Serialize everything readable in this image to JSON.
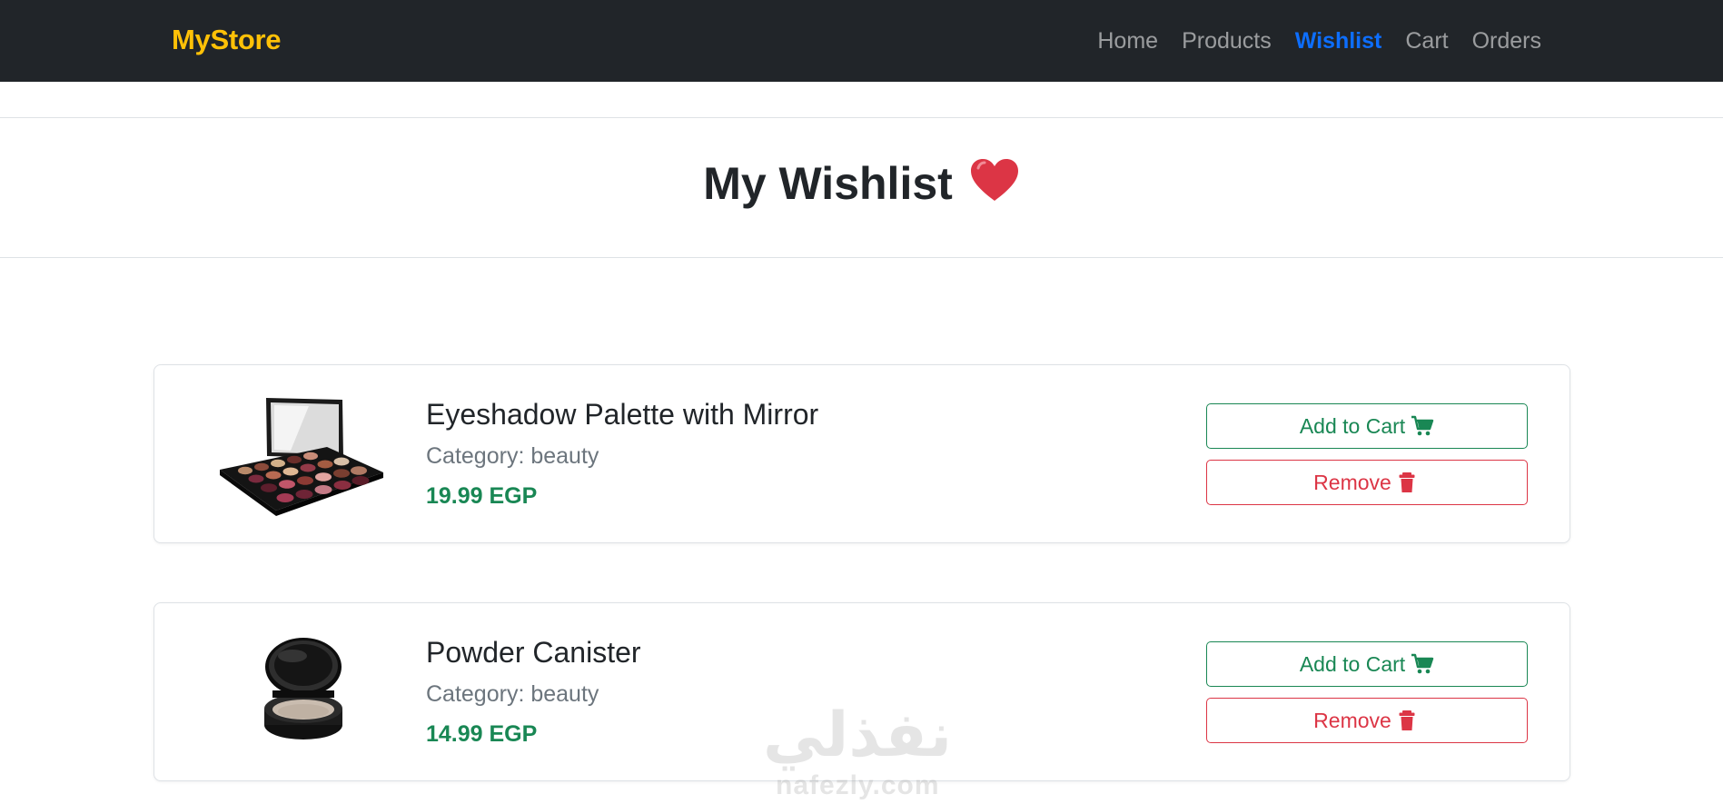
{
  "navbar": {
    "brand": "MyStore",
    "links": [
      {
        "label": "Home",
        "active": false
      },
      {
        "label": "Products",
        "active": false
      },
      {
        "label": "Wishlist",
        "active": true
      },
      {
        "label": "Cart",
        "active": false
      },
      {
        "label": "Orders",
        "active": false
      }
    ],
    "colors": {
      "background": "#212529",
      "brand": "#ffc107",
      "active_link": "#0d6efd"
    }
  },
  "page": {
    "title": "My Wishlist",
    "title_icon": "heart-icon"
  },
  "wishlist": {
    "items": [
      {
        "name": "Eyeshadow Palette with Mirror",
        "category_label": "Category:",
        "category_value": "beauty",
        "price": "19.99 EGP",
        "image": "eyeshadow-palette-image",
        "add_to_cart_label": "Add to Cart",
        "add_to_cart_icon": "cart-icon",
        "remove_label": "Remove",
        "remove_icon": "trash-icon"
      },
      {
        "name": "Powder Canister",
        "category_label": "Category:",
        "category_value": "beauty",
        "price": "14.99 EGP",
        "image": "powder-canister-image",
        "add_to_cart_label": "Add to Cart",
        "add_to_cart_icon": "cart-icon",
        "remove_label": "Remove",
        "remove_icon": "trash-icon"
      }
    ]
  },
  "watermark": {
    "arabic": "نفذلي",
    "latin": "nafezly.com"
  },
  "colors": {
    "success": "#198754",
    "danger": "#dc3545",
    "heart": "#dc3545"
  }
}
